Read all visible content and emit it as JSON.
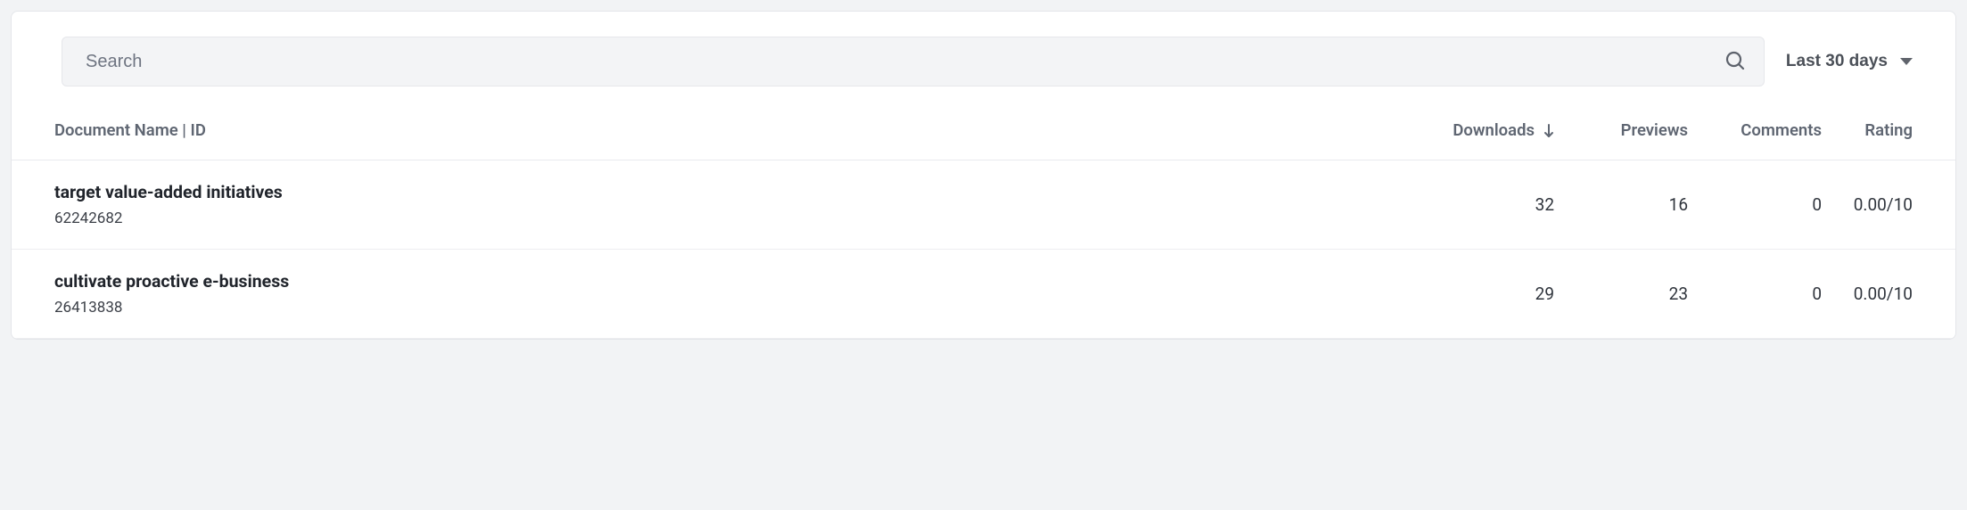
{
  "search": {
    "placeholder": "Search"
  },
  "date_range": {
    "label": "Last 30 days"
  },
  "columns": {
    "name": "Document Name | ID",
    "downloads": "Downloads",
    "previews": "Previews",
    "comments": "Comments",
    "rating": "Rating"
  },
  "sort": {
    "column": "downloads",
    "direction": "desc"
  },
  "rows": [
    {
      "name": "target value-added initiatives",
      "id": "62242682",
      "downloads": "32",
      "previews": "16",
      "comments": "0",
      "rating": "0.00/10"
    },
    {
      "name": "cultivate proactive e-business",
      "id": "26413838",
      "downloads": "29",
      "previews": "23",
      "comments": "0",
      "rating": "0.00/10"
    }
  ]
}
